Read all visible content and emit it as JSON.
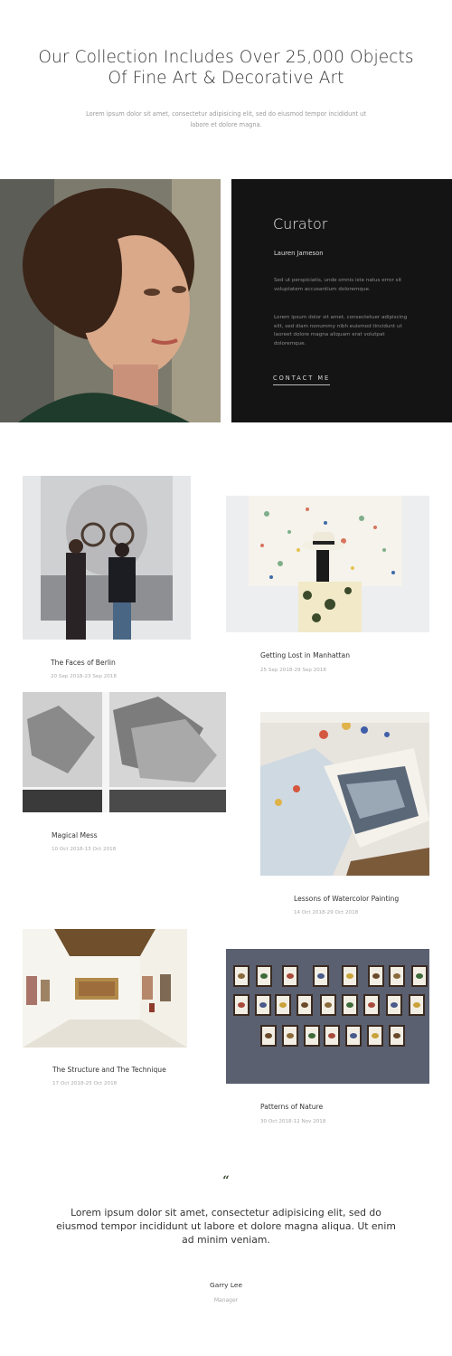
{
  "hero": {
    "title_line1": "Our Collection Includes Over 25,000 Objects",
    "title_line2": "Of Fine Art & Decorative Art",
    "subtitle": "Lorem ipsum dolor sit amet, consectetur adipisicing elit, sed do eiusmod tempor incididunt ut labore et dolore magna."
  },
  "curator": {
    "heading": "Curator",
    "name": "Lauren Jameson",
    "paragraph1": "Sed ut perspiciatis, unde omnis iste natus error sit voluptatem accusantium doloremque.",
    "paragraph2": "Lorem ipsum dolor sit amet, consectetuer adipiscing elit, sed diam nonummy nibh euismod tincidunt ut laoreet dolore magna aliquam erat volutpat doloremque.",
    "button_label": "CONTACT ME"
  },
  "exhibitions": [
    {
      "title": "The Faces of Berlin",
      "dates": "20 Sep 2018-23 Sep 2018"
    },
    {
      "title": "Getting Lost in Manhattan",
      "dates": "25 Sep 2018-29 Sep 2018"
    },
    {
      "title": "Magical Mess",
      "dates": "10 Oct 2018-13 Oct 2018"
    },
    {
      "title": "Lessons of Watercolor Painting",
      "dates": "14 Oct 2018-29 Oct 2018"
    },
    {
      "title": "The Structure and The Technique",
      "dates": "17 Oct 2018-25 Oct 2018"
    },
    {
      "title": "Patterns of Nature",
      "dates": "30 Oct 2018-12 Nov 2018"
    }
  ],
  "testimonial": {
    "mark": "“",
    "text": "Lorem ipsum dolor sit amet, consectetur adipisicing elit, sed do eiusmod tempor incididunt ut labore et dolore magna aliqua. Ut enim ad minim veniam.",
    "author": "Garry Lee",
    "role": "Manager"
  },
  "colors": {
    "curator_background": "#141414",
    "quote_mark": "#3b4a2f"
  }
}
